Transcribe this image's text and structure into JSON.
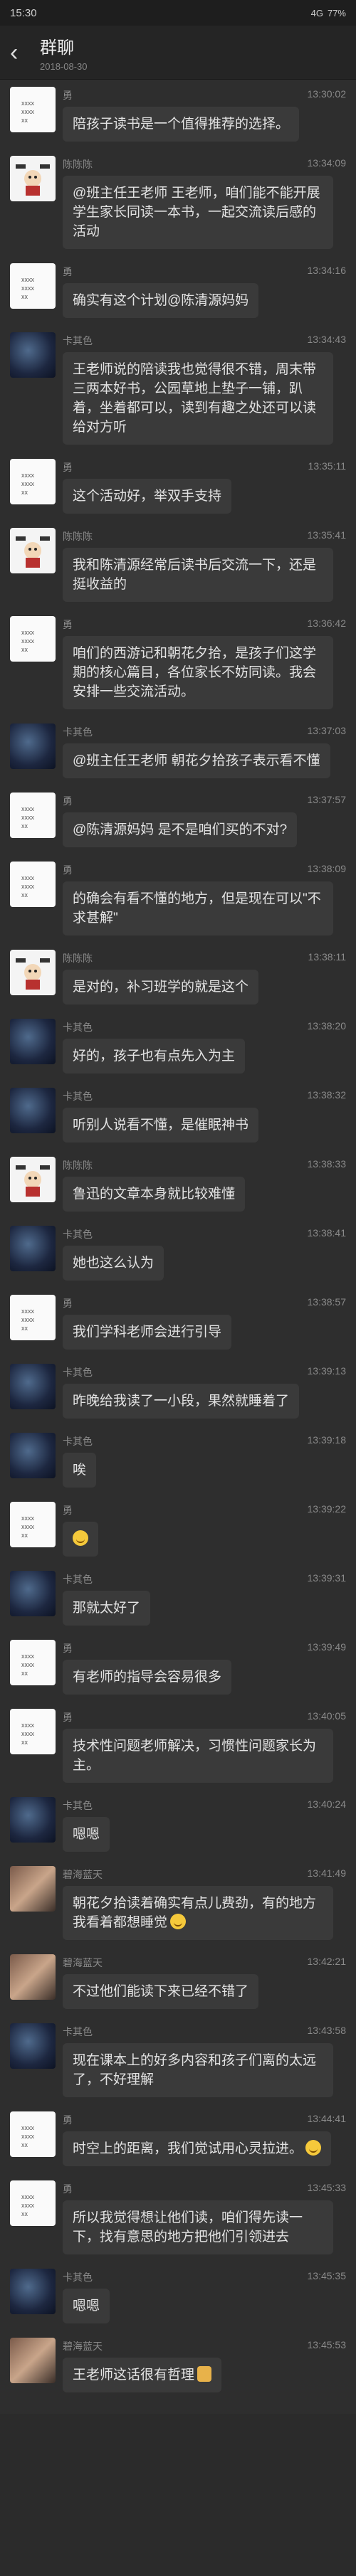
{
  "status": {
    "time": "15:30",
    "signal": "4G",
    "battery": "77%"
  },
  "header": {
    "title": "群聊",
    "subtitle": "2018-08-30"
  },
  "messages": [
    {
      "sender": "勇",
      "avatar": "yong",
      "time": "13:30:02",
      "text": "陪孩子读书是一个值得推荐的选择。"
    },
    {
      "sender": "陈陈陈",
      "avatar": "chen",
      "time": "13:34:09",
      "text": "@班主任王老师 王老师，咱们能不能开展学生家长同读一本书，一起交流读后感的活动"
    },
    {
      "sender": "勇",
      "avatar": "yong",
      "time": "13:34:16",
      "text": "确实有这个计划@陈清源妈妈"
    },
    {
      "sender": "卡其色",
      "avatar": "ka",
      "time": "13:34:43",
      "text": "王老师说的陪读我也觉得很不错，周末带三两本好书，公园草地上垫子一铺，趴着，坐着都可以，读到有趣之处还可以读给对方听"
    },
    {
      "sender": "勇",
      "avatar": "yong",
      "time": "13:35:11",
      "text": "这个活动好，举双手支持"
    },
    {
      "sender": "陈陈陈",
      "avatar": "chen",
      "time": "13:35:41",
      "text": "我和陈清源经常后读书后交流一下，还是挺收益的"
    },
    {
      "sender": "勇",
      "avatar": "yong",
      "time": "13:36:42",
      "text": "咱们的西游记和朝花夕拾，是孩子们这学期的核心篇目，各位家长不妨同读。我会安排一些交流活动。"
    },
    {
      "sender": "卡其色",
      "avatar": "ka",
      "time": "13:37:03",
      "text": "@班主任王老师 朝花夕拾孩子表示看不懂"
    },
    {
      "sender": "勇",
      "avatar": "yong",
      "time": "13:37:57",
      "text": "@陈清源妈妈 是不是咱们买的不对?"
    },
    {
      "sender": "勇",
      "avatar": "yong",
      "time": "13:38:09",
      "text": "的确会有看不懂的地方，但是现在可以\"不求甚解\""
    },
    {
      "sender": "陈陈陈",
      "avatar": "chen",
      "time": "13:38:11",
      "text": "是对的，补习班学的就是这个"
    },
    {
      "sender": "卡其色",
      "avatar": "ka",
      "time": "13:38:20",
      "text": "好的，孩子也有点先入为主"
    },
    {
      "sender": "卡其色",
      "avatar": "ka",
      "time": "13:38:32",
      "text": "听别人说看不懂，是催眠神书"
    },
    {
      "sender": "陈陈陈",
      "avatar": "chen",
      "time": "13:38:33",
      "text": "鲁迅的文章本身就比较难懂"
    },
    {
      "sender": "卡其色",
      "avatar": "ka",
      "time": "13:38:41",
      "text": "她也这么认为"
    },
    {
      "sender": "勇",
      "avatar": "yong",
      "time": "13:38:57",
      "text": "我们学科老师会进行引导"
    },
    {
      "sender": "卡其色",
      "avatar": "ka",
      "time": "13:39:13",
      "text": "昨晚给我读了一小段，果然就睡着了"
    },
    {
      "sender": "卡其色",
      "avatar": "ka",
      "time": "13:39:18",
      "text": "唉"
    },
    {
      "sender": "勇",
      "avatar": "yong",
      "time": "13:39:22",
      "text": "",
      "emoji": true
    },
    {
      "sender": "卡其色",
      "avatar": "ka",
      "time": "13:39:31",
      "text": "那就太好了"
    },
    {
      "sender": "勇",
      "avatar": "yong",
      "time": "13:39:49",
      "text": "有老师的指导会容易很多"
    },
    {
      "sender": "勇",
      "avatar": "yong",
      "time": "13:40:05",
      "text": "技术性问题老师解决，习惯性问题家长为主。"
    },
    {
      "sender": "卡其色",
      "avatar": "ka",
      "time": "13:40:24",
      "text": "嗯嗯"
    },
    {
      "sender": "碧海蓝天",
      "avatar": "bi",
      "time": "13:41:49",
      "text": "朝花夕拾读着确实有点儿费劲，有的地方我看着都想睡觉",
      "emoji": true
    },
    {
      "sender": "碧海蓝天",
      "avatar": "bi",
      "time": "13:42:21",
      "text": "不过他们能读下来已经不错了"
    },
    {
      "sender": "卡其色",
      "avatar": "ka",
      "time": "13:43:58",
      "text": "现在课本上的好多内容和孩子们离的太远了，不好理解"
    },
    {
      "sender": "勇",
      "avatar": "yong",
      "time": "13:44:41",
      "text": "时空上的距离，我们觉试用心灵拉进。",
      "emoji": true
    },
    {
      "sender": "勇",
      "avatar": "yong",
      "time": "13:45:33",
      "text": "所以我觉得想让他们读，咱们得先读一下，找有意思的地方把他们引领进去"
    },
    {
      "sender": "卡其色",
      "avatar": "ka",
      "time": "13:45:35",
      "text": "嗯嗯"
    },
    {
      "sender": "碧海蓝天",
      "avatar": "bi",
      "time": "13:45:53",
      "text": "王老师这话很有哲理",
      "thumb": true
    }
  ]
}
